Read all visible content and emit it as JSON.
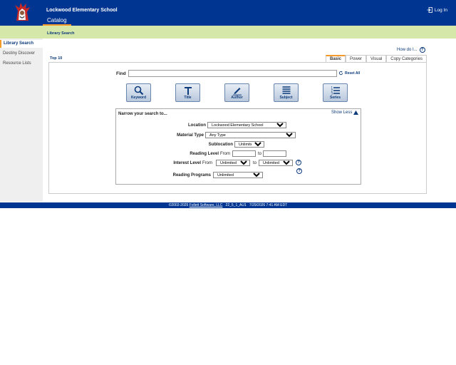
{
  "header": {
    "school_name": "Lockwood Elementary School",
    "catalog_tab": "Catalog",
    "login_label": "Log In"
  },
  "subnav": {
    "title": "Library Search"
  },
  "sidebar": {
    "items": [
      {
        "label": "Library Search"
      },
      {
        "label": "Destiny Discover"
      },
      {
        "label": "Resource Lists"
      }
    ]
  },
  "content": {
    "how_do_i": "How do I...",
    "top10": "Top 10",
    "tabs": [
      "Basic",
      "Power",
      "Visual",
      "Copy Categories"
    ],
    "find_label": "Find",
    "find_value": "",
    "reset_all": "Reset All",
    "search_buttons": [
      "Keyword",
      "Title",
      "Author",
      "Subject",
      "Series"
    ]
  },
  "narrow": {
    "title": "Narrow your search to...",
    "show_less": "Show Less",
    "location_label": "Location",
    "location_value": "Lockwood Elementary School",
    "material_label": "Material Type",
    "material_value": "Any Type",
    "sublocation_label": "Sublocation",
    "sublocation_value": "Unlimited",
    "reading_label": "Reading Level",
    "from_label": "From",
    "to_label": "to",
    "interest_label": "Interest Level",
    "interest_from": "Unlimited",
    "interest_to": "Unlimited",
    "programs_label": "Reading Programs",
    "programs_value": "Unlimited"
  },
  "footer": {
    "copyright": "©2002-2025",
    "company": "Follett Software, LLC",
    "version": "22_5_1_AU1",
    "datetime": "7/29/2026 7:41 AM EDT"
  },
  "colors": {
    "brand": "#003591",
    "accent": "#f39a2a",
    "subnav": "#d6e8a9"
  }
}
